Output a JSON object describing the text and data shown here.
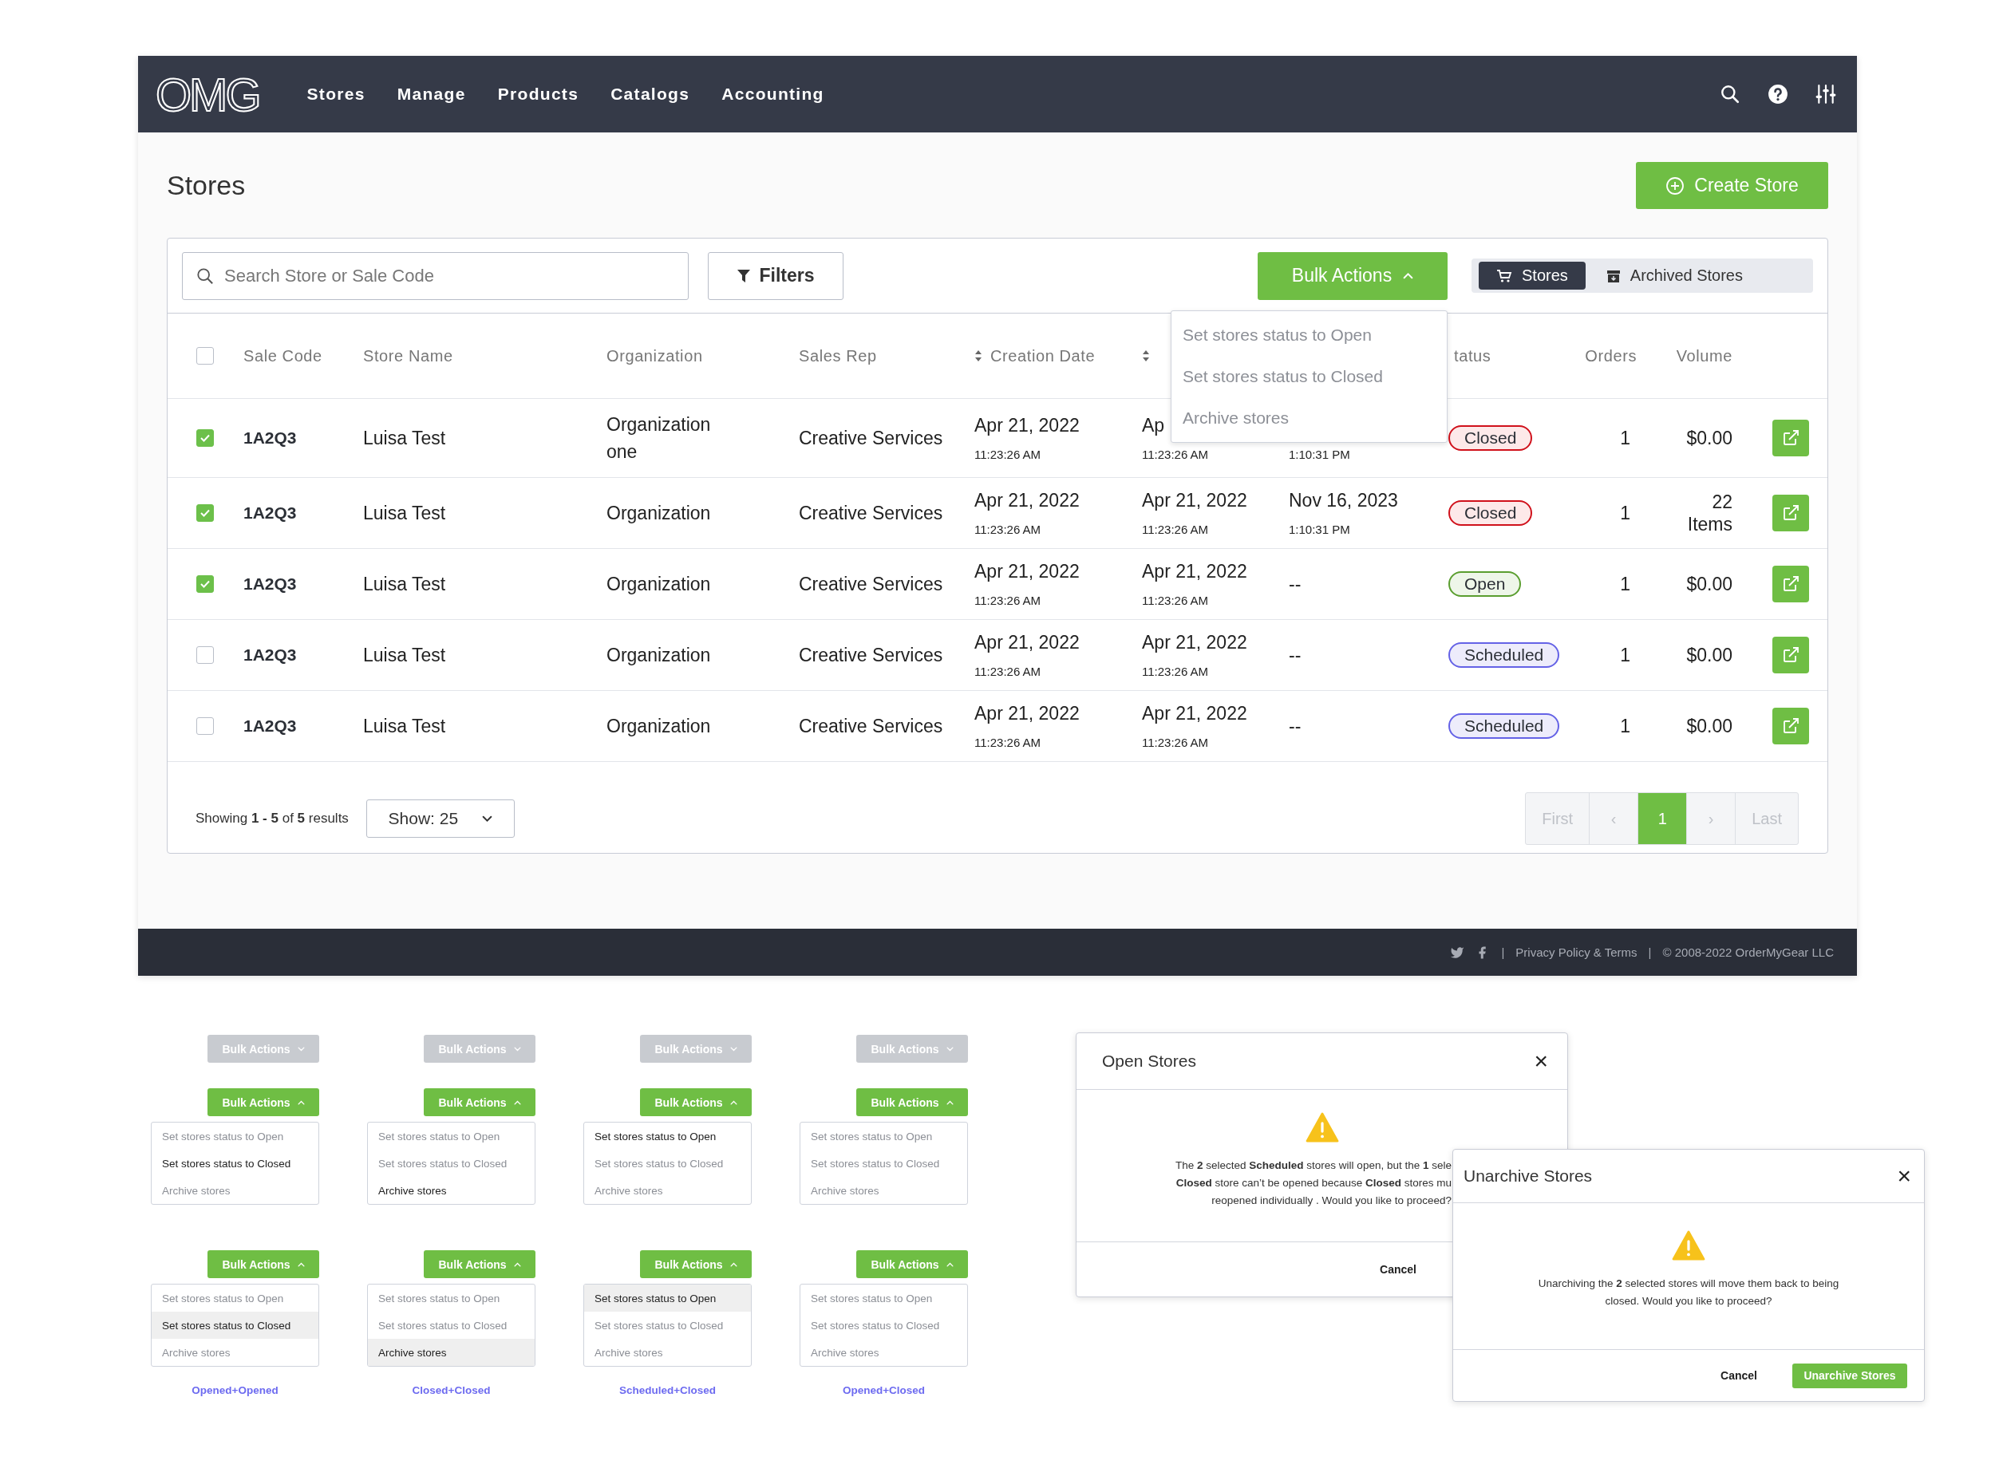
{
  "nav": {
    "logo": "OMG",
    "items": [
      "Stores",
      "Manage",
      "Products",
      "Catalogs",
      "Accounting"
    ]
  },
  "page": {
    "title": "Stores",
    "create_button": "Create Store"
  },
  "toolbar": {
    "search": {
      "placeholder": "Search Store or Sale Code"
    },
    "filters": "Filters",
    "bulk_actions": {
      "label": "Bulk Actions",
      "expanded": true,
      "menu": [
        {
          "label": "Set stores status to Open",
          "enabled": false
        },
        {
          "label": "Set stores status to Closed",
          "enabled": false
        },
        {
          "label": "Archive stores",
          "enabled": false
        }
      ]
    },
    "view_tabs": [
      {
        "label": "Stores",
        "selected": true
      },
      {
        "label": "Archived Stores",
        "selected": false
      }
    ]
  },
  "table": {
    "select_all": {
      "checked": false
    },
    "columns": [
      {
        "label": "Sale Code",
        "sortable": false
      },
      {
        "label": "Store Name",
        "sortable": false
      },
      {
        "label": "Organization",
        "sortable": false
      },
      {
        "label": "Sales Rep",
        "sortable": false
      },
      {
        "label": "Creation Date",
        "sortable": true
      },
      {
        "sortable": true
      },
      {},
      {
        "label": "tatus",
        "sortable": false
      },
      {
        "label": "Orders",
        "sortable": false
      },
      {
        "label": "Volume",
        "sortable": false
      }
    ],
    "rows": [
      {
        "checked": true,
        "sale_code": "1A2Q3",
        "store_name": "Luisa Test",
        "organization": "Organization one",
        "sales_rep": "Creative Services",
        "creation_date": {
          "date": "Apr 21, 2022",
          "time": "11:23:26 AM"
        },
        "column_7": {
          "date": "Ap",
          "time": "11:23:26 AM"
        },
        "column_8": {
          "time": "1:10:31 PM"
        },
        "status": {
          "label": "Closed",
          "kind": "closed"
        },
        "orders": "1",
        "volume": "$0.00"
      },
      {
        "checked": true,
        "sale_code": "1A2Q3",
        "store_name": "Luisa Test",
        "organization": "Organization",
        "sales_rep": "Creative Services",
        "creation_date": {
          "date": "Apr 21, 2022",
          "time": "11:23:26 AM"
        },
        "column_7": {
          "date": "Apr 21, 2022",
          "time": "11:23:26 AM"
        },
        "column_8": {
          "date": "Nov 16, 2023",
          "time": "1:10:31 PM"
        },
        "status": {
          "label": "Closed",
          "kind": "closed"
        },
        "orders": "1",
        "volume": "22 Items"
      },
      {
        "checked": true,
        "sale_code": "1A2Q3",
        "store_name": "Luisa Test",
        "organization": "Organization",
        "sales_rep": "Creative Services",
        "creation_date": {
          "date": "Apr 21, 2022",
          "time": "11:23:26 AM"
        },
        "column_7": {
          "date": "Apr 21, 2022",
          "time": "11:23:26 AM"
        },
        "column_8": {
          "date": "--"
        },
        "status": {
          "label": "Open",
          "kind": "open"
        },
        "orders": "1",
        "volume": "$0.00"
      },
      {
        "checked": false,
        "sale_code": "1A2Q3",
        "store_name": "Luisa Test",
        "organization": "Organization",
        "sales_rep": "Creative Services",
        "creation_date": {
          "date": "Apr 21, 2022",
          "time": "11:23:26 AM"
        },
        "column_7": {
          "date": "Apr 21, 2022",
          "time": "11:23:26 AM"
        },
        "column_8": {
          "date": "--"
        },
        "status": {
          "label": "Scheduled",
          "kind": "scheduled"
        },
        "orders": "1",
        "volume": "$0.00"
      },
      {
        "checked": false,
        "sale_code": "1A2Q3",
        "store_name": "Luisa Test",
        "organization": "Organization",
        "sales_rep": "Creative Services",
        "creation_date": {
          "date": "Apr 21, 2022",
          "time": "11:23:26 AM"
        },
        "column_7": {
          "date": "Apr 21, 2022",
          "time": "11:23:26 AM"
        },
        "column_8": {
          "date": "--"
        },
        "status": {
          "label": "Scheduled",
          "kind": "scheduled"
        },
        "orders": "1",
        "volume": "$0.00"
      }
    ]
  },
  "footer_bar": {
    "showing": "Showing **1 - 5** of **5** results",
    "page_size": "Show: 25",
    "pagination": [
      {
        "label": "First",
        "disabled": true,
        "selected": false
      },
      {
        "label": "‹",
        "disabled": true,
        "selected": false
      },
      {
        "label": "1",
        "disabled": false,
        "selected": true
      },
      {
        "label": "›",
        "disabled": true,
        "selected": false
      },
      {
        "label": "Last",
        "disabled": true,
        "selected": false
      }
    ]
  },
  "site_footer": {
    "items": [
      "|",
      "Privacy Policy & Terms",
      "|",
      "© 2008-2022 OrderMyGear LLC"
    ]
  },
  "bulk_action_variants": [
    {
      "closed_button": {
        "label": "Bulk Actions",
        "disabled": true,
        "expanded": false
      },
      "menus": [
        {
          "button": {
            "label": "Bulk Actions",
            "disabled": false,
            "expanded": true
          },
          "items": [
            {
              "label": "Set stores status to Open",
              "enabled": false,
              "highlighted": false
            },
            {
              "label": "Set stores status to Closed",
              "enabled": true,
              "highlighted": false
            },
            {
              "label": "Archive stores",
              "enabled": false,
              "highlighted": false
            }
          ]
        },
        {
          "button": {
            "label": "Bulk Actions",
            "disabled": false,
            "expanded": true
          },
          "items": [
            {
              "label": "Set stores status to Open",
              "enabled": false,
              "highlighted": false
            },
            {
              "label": "Set stores status to Closed",
              "enabled": true,
              "highlighted": true
            },
            {
              "label": "Archive stores",
              "enabled": false,
              "highlighted": false
            }
          ]
        }
      ],
      "caption": "Opened+Opened"
    },
    {
      "closed_button": {
        "label": "Bulk Actions",
        "disabled": true,
        "expanded": false
      },
      "menus": [
        {
          "button": {
            "label": "Bulk Actions",
            "disabled": false,
            "expanded": true
          },
          "items": [
            {
              "label": "Set stores status to Open",
              "enabled": false,
              "highlighted": false
            },
            {
              "label": "Set stores status to Closed",
              "enabled": false,
              "highlighted": false
            },
            {
              "label": "Archive stores",
              "enabled": true,
              "highlighted": false
            }
          ]
        },
        {
          "button": {
            "label": "Bulk Actions",
            "disabled": false,
            "expanded": true
          },
          "items": [
            {
              "label": "Set stores status to Open",
              "enabled": false,
              "highlighted": false
            },
            {
              "label": "Set stores status to Closed",
              "enabled": false,
              "highlighted": false
            },
            {
              "label": "Archive stores",
              "enabled": true,
              "highlighted": true
            }
          ]
        }
      ],
      "caption": "Closed+Closed"
    },
    {
      "closed_button": {
        "label": "Bulk Actions",
        "disabled": true,
        "expanded": false
      },
      "menus": [
        {
          "button": {
            "label": "Bulk Actions",
            "disabled": false,
            "expanded": true
          },
          "items": [
            {
              "label": "Set stores status to Open",
              "enabled": true,
              "highlighted": false
            },
            {
              "label": "Set stores status to Closed",
              "enabled": false,
              "highlighted": false
            },
            {
              "label": "Archive stores",
              "enabled": false,
              "highlighted": false
            }
          ]
        },
        {
          "button": {
            "label": "Bulk Actions",
            "disabled": false,
            "expanded": true
          },
          "items": [
            {
              "label": "Set stores status to Open",
              "enabled": true,
              "highlighted": true
            },
            {
              "label": "Set stores status to Closed",
              "enabled": false,
              "highlighted": false
            },
            {
              "label": "Archive stores",
              "enabled": false,
              "highlighted": false
            }
          ]
        }
      ],
      "caption": "Scheduled+Closed"
    },
    {
      "closed_button": {
        "label": "Bulk Actions",
        "disabled": true,
        "expanded": false
      },
      "menus": [
        {
          "button": {
            "label": "Bulk Actions",
            "disabled": false,
            "expanded": true
          },
          "items": [
            {
              "label": "Set stores status to Open",
              "enabled": false,
              "highlighted": false
            },
            {
              "label": "Set stores status to Closed",
              "enabled": false,
              "highlighted": false
            },
            {
              "label": "Archive stores",
              "enabled": false,
              "highlighted": false
            }
          ]
        },
        {
          "button": {
            "label": "Bulk Actions",
            "disabled": false,
            "expanded": true
          },
          "items": [
            {
              "label": "Set stores status to Open",
              "enabled": false,
              "highlighted": false
            },
            {
              "label": "Set stores status to Closed",
              "enabled": false,
              "highlighted": false
            },
            {
              "label": "Archive stores",
              "enabled": false,
              "highlighted": false
            }
          ]
        }
      ],
      "caption": "Opened+Closed"
    }
  ],
  "dialogs": [
    {
      "title": "Open Stores",
      "close": "×",
      "body_lines": [
        "The **2** selected **Scheduled** stores will open, but the **1** sele",
        "**Closed** store can’t be opened because **Closed** stores mu",
        "reopened individually . Would you like to proceed?"
      ],
      "buttons": [
        {
          "label": "Cancel",
          "kind": "secondary"
        }
      ]
    },
    {
      "title": "Unarchive Stores",
      "close": "×",
      "body_lines": [
        "Unarchiving the **2** selected stores will move them back to being",
        "closed. Would you like to proceed?"
      ],
      "buttons": [
        {
          "label": "Cancel",
          "kind": "secondary"
        },
        {
          "label": "Unarchive Stores",
          "kind": "primary"
        }
      ]
    }
  ]
}
